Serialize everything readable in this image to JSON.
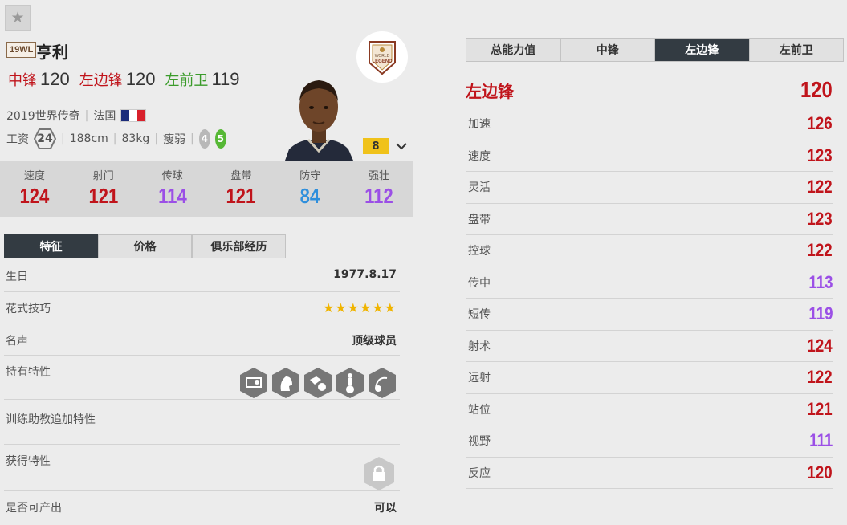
{
  "season_badge": "19WL",
  "player_name": "亨利",
  "positions": [
    {
      "name": "中锋",
      "value": "120",
      "color": "#c0141b"
    },
    {
      "name": "左边锋",
      "value": "120",
      "color": "#c0141b"
    },
    {
      "name": "左前卫",
      "value": "119",
      "color": "#3a9b2a"
    }
  ],
  "info": {
    "season": "2019世界传奇",
    "nation": "法国",
    "salary_label": "工资",
    "salary": "24",
    "height": "188cm",
    "weight": "83kg",
    "body_type": "瘦弱",
    "weak_foot": "4",
    "strong_foot": "5"
  },
  "legend_badge": {
    "line1": "WORLD",
    "line2": "LEGEND"
  },
  "level": "8",
  "stats": [
    {
      "label": "速度",
      "value": "124",
      "color": "#c0141b"
    },
    {
      "label": "射门",
      "value": "121",
      "color": "#c0141b"
    },
    {
      "label": "传球",
      "value": "114",
      "color": "#9b4fe6"
    },
    {
      "label": "盘带",
      "value": "121",
      "color": "#c0141b"
    },
    {
      "label": "防守",
      "value": "84",
      "color": "#2f8fdc"
    },
    {
      "label": "强壮",
      "value": "112",
      "color": "#9b4fe6"
    }
  ],
  "left_tabs": [
    "特征",
    "价格",
    "俱乐部经历"
  ],
  "details": {
    "birthday_label": "生日",
    "birthday": "1977.8.17",
    "skill_label": "花式技巧",
    "skill_stars": 6,
    "fame_label": "名声",
    "fame": "顶级球员",
    "traits_label": "持有特性",
    "coach_traits_label": "训练助教追加特性",
    "acquire_traits_label": "获得特性",
    "producible_label": "是否可产出",
    "producible": "可以"
  },
  "right_tabs": [
    "总能力值",
    "中锋",
    "左边锋",
    "左前卫"
  ],
  "active_position": {
    "name": "左边锋",
    "value": "120"
  },
  "attributes": [
    {
      "name": "加速",
      "value": "126",
      "color": "#c0141b"
    },
    {
      "name": "速度",
      "value": "123",
      "color": "#c0141b"
    },
    {
      "name": "灵活",
      "value": "122",
      "color": "#c0141b"
    },
    {
      "name": "盘带",
      "value": "123",
      "color": "#c0141b"
    },
    {
      "name": "控球",
      "value": "122",
      "color": "#c0141b"
    },
    {
      "name": "传中",
      "value": "113",
      "color": "#9b4fe6"
    },
    {
      "name": "短传",
      "value": "119",
      "color": "#9b4fe6"
    },
    {
      "name": "射术",
      "value": "124",
      "color": "#c0141b"
    },
    {
      "name": "远射",
      "value": "122",
      "color": "#c0141b"
    },
    {
      "name": "站位",
      "value": "121",
      "color": "#c0141b"
    },
    {
      "name": "视野",
      "value": "111",
      "color": "#9b4fe6"
    },
    {
      "name": "反应",
      "value": "120",
      "color": "#c0141b"
    }
  ]
}
